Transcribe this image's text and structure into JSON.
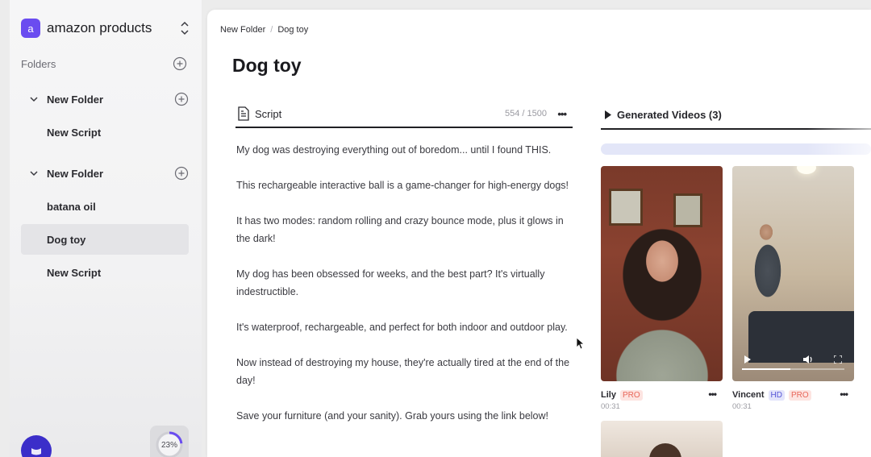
{
  "workspace": {
    "logo_letter": "a",
    "name": "amazon products"
  },
  "sidebar": {
    "folders_label": "Folders",
    "tree": [
      {
        "kind": "folder",
        "label": "New Folder"
      },
      {
        "kind": "item",
        "label": "New Script"
      },
      {
        "kind": "folder",
        "label": "New Folder"
      },
      {
        "kind": "item",
        "label": "batana oil"
      },
      {
        "kind": "item",
        "label": "Dog toy",
        "active": true
      },
      {
        "kind": "item",
        "label": "New Script"
      }
    ],
    "usage_percent": "23%",
    "usage_fraction": 0.23
  },
  "breadcrumb": {
    "parent": "New Folder",
    "separator": "/",
    "current": "Dog toy"
  },
  "page": {
    "title": "Dog toy"
  },
  "script": {
    "label": "Script",
    "char_count": "554 / 1500",
    "more": "•••",
    "paragraphs": [
      "My dog was destroying everything out of boredom... until I found THIS.",
      "This rechargeable interactive ball is a game-changer for high-energy dogs!",
      "It has two modes: random rolling and crazy bounce mode, plus it glows in the dark!",
      "My dog has been obsessed for weeks, and the best part? It's virtually indestructible.",
      "It's waterproof, rechargeable, and perfect for both indoor and outdoor play.",
      "Now instead of destroying my house, they're actually tired at the end of the day!",
      "Save your furniture (and your sanity). Grab yours using the link below!"
    ]
  },
  "videos": {
    "header": "Generated Videos (3)",
    "items": [
      {
        "name": "Lily",
        "badges": [
          "PRO"
        ],
        "duration": "00:31",
        "more": "•••"
      },
      {
        "name": "Vincent",
        "badges": [
          "HD",
          "PRO"
        ],
        "duration": "00:31",
        "more": "•••",
        "playback_progress": 0.47
      }
    ]
  },
  "colors": {
    "accent": "#6a4cf0",
    "avatar": "#3b2ec9",
    "pro_badge": "#e8675a",
    "hd_badge": "#5656d6"
  }
}
